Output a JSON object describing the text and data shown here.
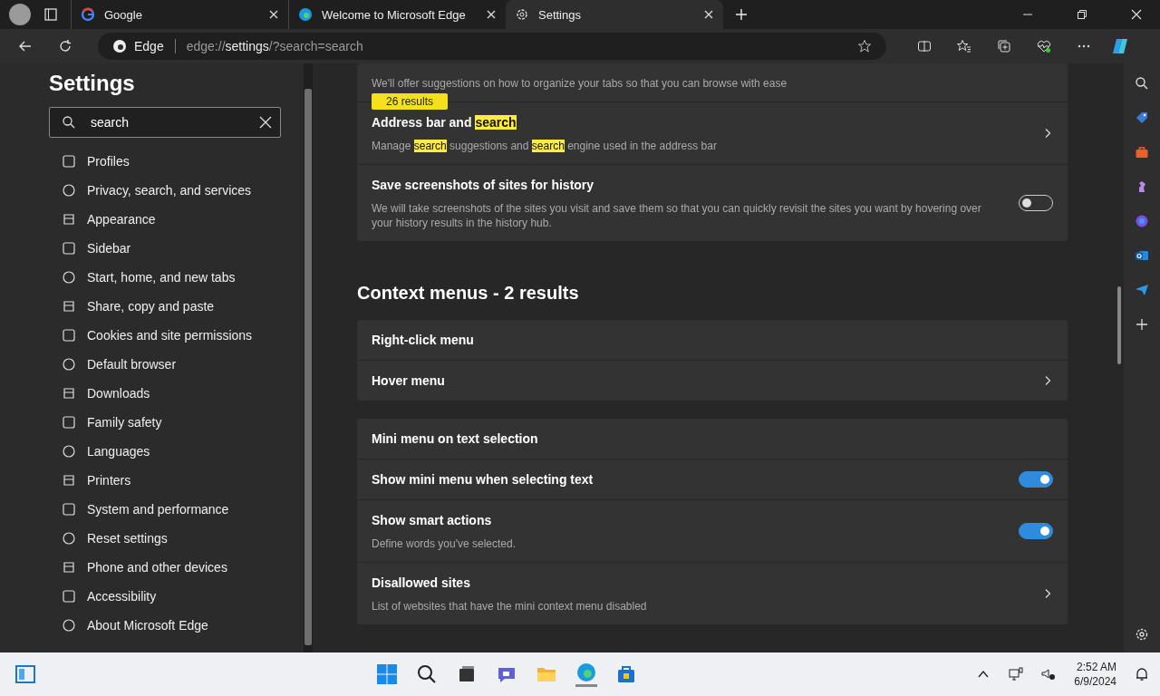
{
  "tabs": [
    {
      "title": "Google",
      "selected": false
    },
    {
      "title": "Welcome to Microsoft Edge",
      "selected": false
    },
    {
      "title": "Settings",
      "selected": true
    }
  ],
  "address_bar": {
    "site_label": "Edge",
    "url_prefix": "edge://",
    "url_host": "settings",
    "url_rest": "/?search=search"
  },
  "sidebar": {
    "title": "Settings",
    "search": {
      "value": "search"
    },
    "items": [
      {
        "label": "Profiles"
      },
      {
        "label": "Privacy, search, and services"
      },
      {
        "label": "Appearance"
      },
      {
        "label": "Sidebar"
      },
      {
        "label": "Start, home, and new tabs"
      },
      {
        "label": "Share, copy and paste"
      },
      {
        "label": "Cookies and site permissions"
      },
      {
        "label": "Default browser"
      },
      {
        "label": "Downloads"
      },
      {
        "label": "Family safety"
      },
      {
        "label": "Languages"
      },
      {
        "label": "Printers"
      },
      {
        "label": "System and performance"
      },
      {
        "label": "Reset settings"
      },
      {
        "label": "Phone and other devices"
      },
      {
        "label": "Accessibility"
      },
      {
        "label": "About Microsoft Edge"
      }
    ]
  },
  "results_badge": "26 results",
  "sections": [
    {
      "cards": [
        [
          {
            "kind": "text",
            "description": [
              {
                "text": "We'll offer suggestions on how to organize your tabs so that you can browse with ease",
                "highlight": false
              }
            ]
          },
          {
            "kind": "link",
            "title": [
              {
                "text": "Address bar and ",
                "highlight": false
              },
              {
                "text": "search",
                "highlight": true
              }
            ],
            "description": [
              {
                "text": "Manage ",
                "highlight": false
              },
              {
                "text": "search",
                "highlight": true
              },
              {
                "text": " suggestions and ",
                "highlight": false
              },
              {
                "text": "search",
                "highlight": true
              },
              {
                "text": " engine used in the address bar",
                "highlight": false
              }
            ]
          },
          {
            "kind": "toggle",
            "on": false,
            "title": [
              {
                "text": "Save screenshots of sites for history",
                "highlight": false
              }
            ],
            "description": [
              {
                "text": "We will take screenshots of the sites you visit and save them so that you can quickly revisit the sites you want by hovering over your history results in the history hub.",
                "highlight": false
              }
            ]
          }
        ]
      ]
    },
    {
      "heading": "Context menus - 2 results",
      "cards": [
        [
          {
            "kind": "text",
            "title": [
              {
                "text": "Right-click menu",
                "highlight": false
              }
            ]
          },
          {
            "kind": "link",
            "title": [
              {
                "text": "Hover menu",
                "highlight": false
              }
            ]
          }
        ],
        [
          {
            "kind": "text",
            "title": [
              {
                "text": "Mini menu on text selection",
                "highlight": false
              }
            ]
          },
          {
            "kind": "toggle",
            "on": true,
            "title": [
              {
                "text": "Show mini menu when selecting text",
                "highlight": false
              }
            ]
          },
          {
            "kind": "toggle",
            "on": true,
            "title": [
              {
                "text": "Show smart actions",
                "highlight": false
              }
            ],
            "description": [
              {
                "text": "Define words you've selected.",
                "highlight": false
              }
            ]
          },
          {
            "kind": "link",
            "title": [
              {
                "text": "Disallowed sites",
                "highlight": false
              }
            ],
            "description": [
              {
                "text": "List of websites that have the mini context menu disabled",
                "highlight": false
              }
            ]
          }
        ]
      ]
    }
  ],
  "taskbar": {
    "time": "2:52 AM",
    "date": "6/9/2024"
  }
}
